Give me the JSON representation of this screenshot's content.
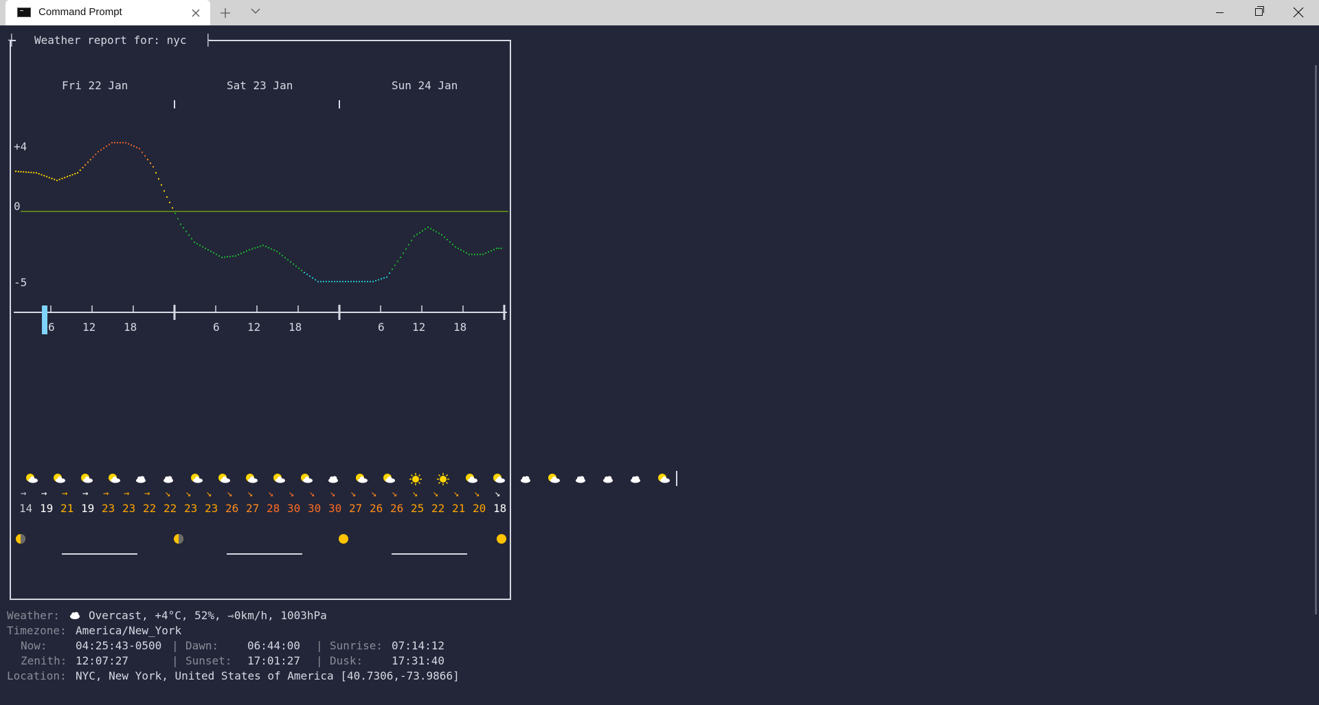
{
  "window": {
    "tab_title": "Command Prompt",
    "tab_icon": "terminal-icon",
    "close_tab_icon": "close-icon",
    "new_tab_icon": "plus-icon",
    "dropdown_icon": "chevron-down-icon"
  },
  "report": {
    "title": "Weather report for: nyc",
    "days": [
      "Fri 22 Jan",
      "Sat 23 Jan",
      "Sun 24 Jan"
    ],
    "y_labels": [
      "+4",
      "0",
      "-5"
    ],
    "hour_ticks": [
      "6",
      "12",
      "18",
      "6",
      "12",
      "18",
      "6",
      "12",
      "18"
    ]
  },
  "chart_data": {
    "type": "line",
    "title": "",
    "xlabel": "",
    "ylabel": "",
    "ylim": [
      -5.5,
      5
    ],
    "x_unit": "hours since Fri 22 Jan 00:00",
    "series": [
      {
        "name": "",
        "x": [
          0,
          3,
          6,
          9,
          12,
          14,
          16,
          18,
          20,
          22,
          24,
          26,
          28,
          30,
          32,
          34,
          36,
          38,
          40,
          42,
          44,
          46,
          48,
          50,
          52,
          54,
          56,
          58,
          60,
          62,
          64,
          66,
          68,
          70,
          71
        ],
        "y": [
          2.7,
          2.6,
          2.1,
          2.6,
          4.0,
          4.6,
          4.6,
          4.2,
          3.0,
          1.0,
          -0.8,
          -2.0,
          -2.5,
          -3.0,
          -2.9,
          -2.5,
          -2.2,
          -2.6,
          -3.3,
          -4.0,
          -4.6,
          -4.6,
          -4.6,
          -4.6,
          -4.6,
          -4.3,
          -3.0,
          -1.6,
          -1.0,
          -1.5,
          -2.3,
          -2.8,
          -2.8,
          -2.4,
          -2.4
        ]
      }
    ],
    "colors": {
      "warm": "#ffd400",
      "warmest": "#e8622a",
      "cool": "#19b52e",
      "coldest": "#22c6d6",
      "zero_line": "#8fd400"
    }
  },
  "forecast": {
    "icons": [
      "cloud-sun-icon",
      "cloud-sun-icon",
      "cloud-sun-icon",
      "cloud-sun-icon",
      "cloud-icon",
      "cloud-icon",
      "cloud-sun-icon",
      "cloud-sun-icon",
      "cloud-sun-icon",
      "cloud-sun-icon",
      "cloud-sun-icon",
      "cloud-icon",
      "cloud-sun-icon",
      "cloud-sun-icon",
      "sun-icon",
      "sun-icon",
      "cloud-sun-icon",
      "cloud-sun-icon",
      "cloud-icon",
      "cloud-sun-icon",
      "cloud-icon",
      "cloud-icon",
      "cloud-icon",
      "cloud-sun-icon"
    ],
    "wind_arrows": [
      "→",
      "→",
      "→",
      "→",
      "→",
      "→",
      "→",
      "↘",
      "↘",
      "↘",
      "↘",
      "↘",
      "↘",
      "↘",
      "↘",
      "↘",
      "↘",
      "↘",
      "↘",
      "↘",
      "↘",
      "↘",
      "↘",
      "↘"
    ],
    "wind_speeds": [
      "14",
      "19",
      "21",
      "19",
      "23",
      "23",
      "22",
      "22",
      "23",
      "23",
      "26",
      "27",
      "28",
      "30",
      "30",
      "30",
      "27",
      "26",
      "26",
      "25",
      "22",
      "21",
      "20",
      "18"
    ],
    "wind_colors": [
      "#c8cad3",
      "#ffffff",
      "#ffb300",
      "#ffffff",
      "#ffa500",
      "#ffa500",
      "#ffa500",
      "#ffa500",
      "#ffa500",
      "#ffa500",
      "#ff8a1a",
      "#ff8a1a",
      "#ff6b24",
      "#ff6b24",
      "#ff6b24",
      "#ff6b24",
      "#ff8a1a",
      "#ff8a1a",
      "#ff8a1a",
      "#ffa500",
      "#ffa500",
      "#ffa500",
      "#ffa500",
      "#ffffff"
    ],
    "moon_icons": [
      "moon-last-quarter-icon",
      "moon-first-quarter-icon",
      "moon-waxing-gibbous-icon",
      "moon-waxing-gibbous-icon"
    ]
  },
  "info": {
    "weather_label": "Weather:",
    "weather_icon": "cloud-icon",
    "weather_value": "Overcast, +4°C, 52%, ⇾0km/h, 1003hPa",
    "timezone_label": "Timezone:",
    "timezone_value": "America/New_York",
    "now_label": "Now:",
    "now_value": "04:25:43-0500",
    "dawn_label": "Dawn:",
    "dawn_value": "06:44:00",
    "sunrise_label": "Sunrise:",
    "sunrise_value": "07:14:12",
    "zenith_label": "Zenith:",
    "zenith_value": "12:07:27",
    "sunset_label": "Sunset:",
    "sunset_value": "17:01:27",
    "dusk_label": "Dusk:",
    "dusk_value": "17:31:40",
    "location_label": "Location:",
    "location_value": "NYC, New York, United States of America [40.7306,-73.9866]"
  }
}
